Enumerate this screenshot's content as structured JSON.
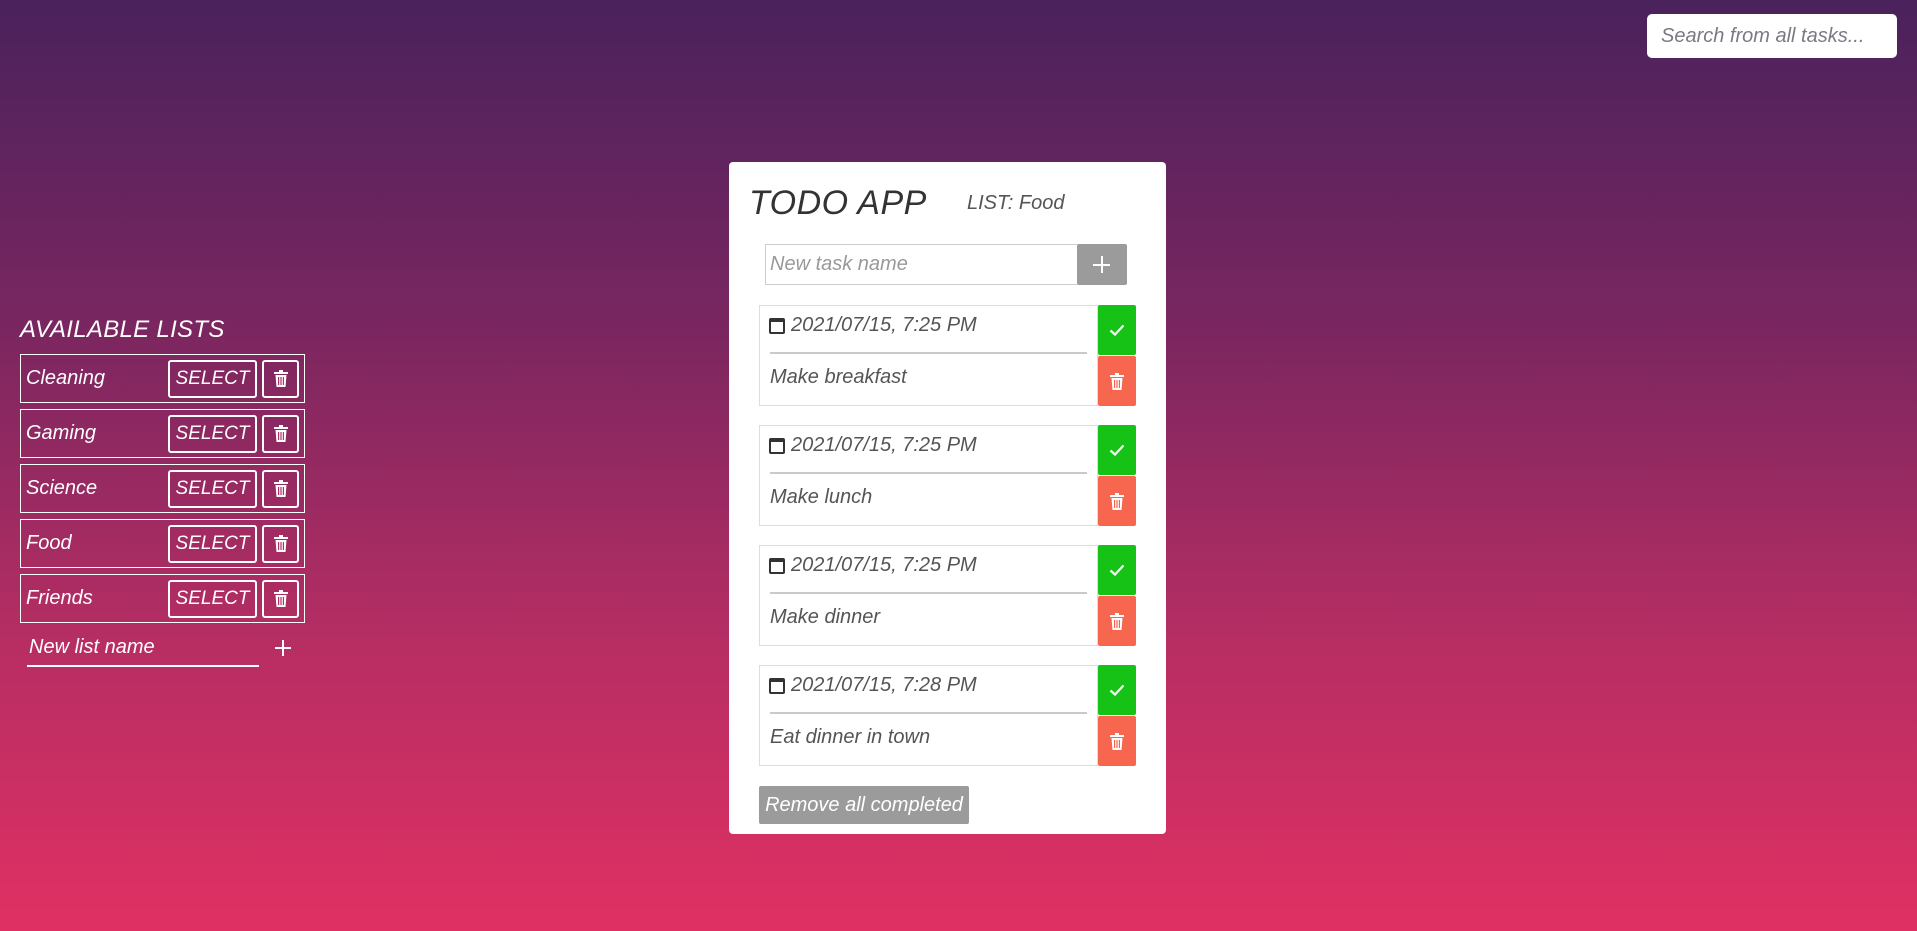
{
  "search": {
    "placeholder": "Search from all tasks..."
  },
  "sidebar": {
    "title": "AVAILABLE LISTS",
    "select_label": "SELECT",
    "lists": [
      {
        "name": "Cleaning"
      },
      {
        "name": "Gaming"
      },
      {
        "name": "Science"
      },
      {
        "name": "Food"
      },
      {
        "name": "Friends"
      }
    ],
    "new_list_placeholder": "New list name"
  },
  "app": {
    "title": "TODO APP",
    "list_label": "LIST: Food",
    "new_task_placeholder": "New task name",
    "remove_all_label": "Remove all completed"
  },
  "tasks": [
    {
      "date": "2021/07/15, 7:25 PM",
      "name": "Make breakfast"
    },
    {
      "date": "2021/07/15, 7:25 PM",
      "name": "Make lunch"
    },
    {
      "date": "2021/07/15, 7:25 PM",
      "name": "Make dinner"
    },
    {
      "date": "2021/07/15, 7:28 PM",
      "name": "Eat dinner in town"
    }
  ],
  "colors": {
    "done": "#16c216",
    "remove": "#f7674f",
    "neutral_button": "#9b9b9b"
  },
  "icons": {
    "add": "plus-icon",
    "delete": "trash-icon",
    "complete": "check-icon",
    "date": "calendar-icon"
  }
}
